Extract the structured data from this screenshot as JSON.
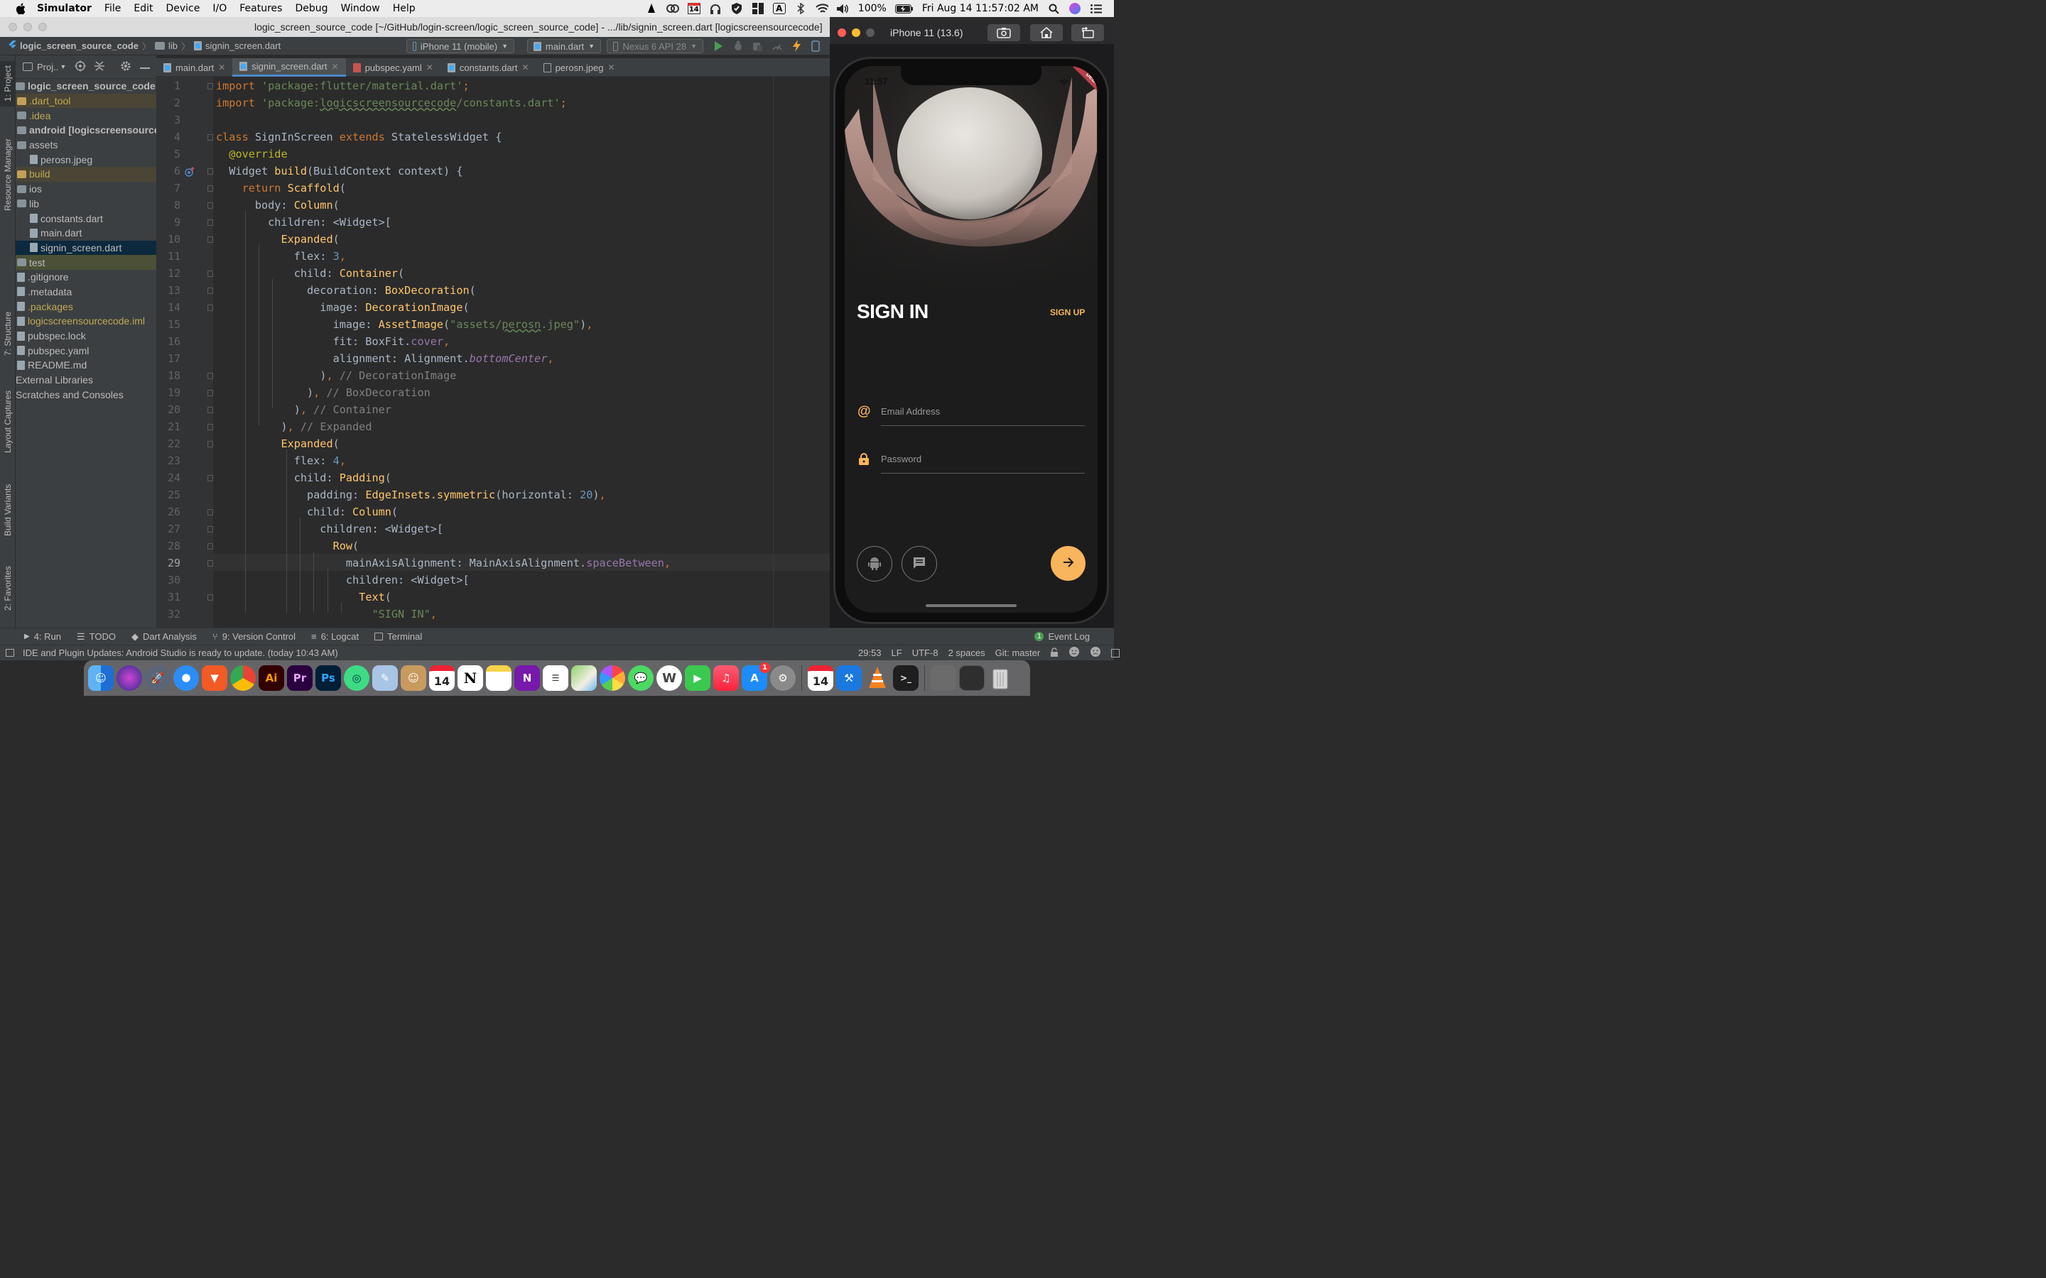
{
  "menubar": {
    "app": "Simulator",
    "items": [
      "File",
      "Edit",
      "Device",
      "I/O",
      "Features",
      "Debug",
      "Window",
      "Help"
    ],
    "calendar_day": "14",
    "battery": "100%",
    "datetime": "Fri Aug 14  11:57:02 AM"
  },
  "window": {
    "title": "logic_screen_source_code [~/GitHub/login-screen/logic_screen_source_code] - .../lib/signin_screen.dart [logicscreensourcecode]"
  },
  "navbar": {
    "crumbs": [
      "logic_screen_source_code",
      "lib",
      "signin_screen.dart"
    ],
    "device": "iPhone 11 (mobile)",
    "run_config": "main.dart",
    "avd": "Nexus 6 API 28"
  },
  "sidebar_tabs": [
    "1: Project",
    "Resource Manager",
    "7: Structure",
    "Layout Captures",
    "Build Variants",
    "2: Favorites"
  ],
  "project": {
    "header": "Proj..",
    "tree": [
      {
        "label": "logic_screen_source_code [logi",
        "indent": 0,
        "kind": "folder",
        "style": "bold"
      },
      {
        "label": ".dart_tool",
        "indent": 1,
        "kind": "folder-y",
        "style": "yellow",
        "hl": "y"
      },
      {
        "label": ".idea",
        "indent": 1,
        "kind": "folder",
        "style": "yellow"
      },
      {
        "label": "android [logicscreensourcec",
        "indent": 1,
        "kind": "folder",
        "style": "bold"
      },
      {
        "label": "assets",
        "indent": 1,
        "kind": "folder",
        "style": ""
      },
      {
        "label": "perosn.jpeg",
        "indent": 2,
        "kind": "file",
        "style": ""
      },
      {
        "label": "build",
        "indent": 1,
        "kind": "folder-y",
        "style": "yellow",
        "hl": "y"
      },
      {
        "label": "ios",
        "indent": 1,
        "kind": "folder",
        "style": ""
      },
      {
        "label": "lib",
        "indent": 1,
        "kind": "folder",
        "style": ""
      },
      {
        "label": "constants.dart",
        "indent": 2,
        "kind": "dart",
        "style": ""
      },
      {
        "label": "main.dart",
        "indent": 2,
        "kind": "dart",
        "style": ""
      },
      {
        "label": "signin_screen.dart",
        "indent": 2,
        "kind": "dart",
        "style": "",
        "hl": "sel"
      },
      {
        "label": "test",
        "indent": 1,
        "kind": "folder",
        "style": "",
        "hl": "g"
      },
      {
        "label": ".gitignore",
        "indent": 1,
        "kind": "file",
        "style": ""
      },
      {
        "label": ".metadata",
        "indent": 1,
        "kind": "file",
        "style": ""
      },
      {
        "label": ".packages",
        "indent": 1,
        "kind": "file",
        "style": "yellow"
      },
      {
        "label": "logicscreensourcecode.iml",
        "indent": 1,
        "kind": "file",
        "style": "yellow"
      },
      {
        "label": "pubspec.lock",
        "indent": 1,
        "kind": "file",
        "style": ""
      },
      {
        "label": "pubspec.yaml",
        "indent": 1,
        "kind": "file",
        "style": ""
      },
      {
        "label": "README.md",
        "indent": 1,
        "kind": "file",
        "style": ""
      },
      {
        "label": "External Libraries",
        "indent": 0,
        "kind": "none",
        "style": ""
      },
      {
        "label": "Scratches and Consoles",
        "indent": 0,
        "kind": "none",
        "style": ""
      }
    ]
  },
  "tabs": [
    "main.dart",
    "signin_screen.dart",
    "pubspec.yaml",
    "constants.dart",
    "perosn.jpeg"
  ],
  "active_tab": 1,
  "editor": {
    "current_line": 29,
    "lines": [
      "<span class=\"kw\">import </span><span class=\"str\">'package:flutter/material.dart'</span><span class=\"kw\">;</span>",
      "<span class=\"kw\">import </span><span class=\"str\">'package:<span class=\"ul\">logicscreensourcecode</span>/constants.dart'</span><span class=\"kw\">;</span>",
      "",
      "<span class=\"kw\">class </span>SignInScreen <span class=\"kw\">extends </span>StatelessWidget {",
      "  <span class=\"ann\">@override</span>",
      "  Widget <span class=\"cls\">build</span>(BuildContext context) {",
      "    <span class=\"kw\">return </span><span class=\"cls\">Scaffold</span>(",
      "      body: <span class=\"cls\">Column</span>(",
      "        children: &lt;Widget&gt;[",
      "          <span class=\"cls\">Expanded</span>(",
      "            flex: <span class=\"num\">3</span><span class=\"kw\">,</span>",
      "            child: <span class=\"cls\">Container</span>(",
      "              decoration: <span class=\"cls\">BoxDecoration</span>(",
      "                image: <span class=\"cls\">DecorationImage</span>(",
      "                  image: <span class=\"cls\">AssetImage</span>(<span class=\"str\">\"assets/<span class=\"ul\">perosn</span>.jpeg\"</span>)<span class=\"kw\">,</span>",
      "                  fit: BoxFit.<span class=\"fld\">cover</span><span class=\"kw\">,</span>",
      "                  alignment: Alignment.<span class=\"fld it\">bottomCenter</span><span class=\"kw\">,</span>",
      "                )<span class=\"kw\">, </span><span class=\"cm\">// DecorationImage</span>",
      "              )<span class=\"kw\">, </span><span class=\"cm\">// BoxDecoration</span>",
      "            )<span class=\"kw\">, </span><span class=\"cm\">// Container</span>",
      "          )<span class=\"kw\">, </span><span class=\"cm\">// Expanded</span>",
      "          <span class=\"cls\">Expanded</span>(",
      "            flex: <span class=\"num\">4</span><span class=\"kw\">,</span>",
      "            child: <span class=\"cls\">Padding</span>(",
      "              padding: <span class=\"cls\">EdgeInsets.symmetric</span>(horizontal: <span class=\"num\">20</span>)<span class=\"kw\">,</span>",
      "              child: <span class=\"cls\">Column</span>(",
      "                children: &lt;Widget&gt;[",
      "                  <span class=\"cls\">Row</span>(",
      "                    mainAxisAlignment: MainAxisAlignment.<span class=\"fld\">spaceBetween</span><span class=\"kw\">,</span>",
      "                    children: &lt;Widget&gt;[",
      "                      <span class=\"cls\">Text</span>(",
      "                        <span class=\"str\">\"SIGN IN\"</span><span class=\"kw\">,</span>"
    ]
  },
  "toolwindows": [
    "4: Run",
    "TODO",
    "Dart Analysis",
    "9: Version Control",
    "6: Logcat",
    "Terminal"
  ],
  "event_log": {
    "count": "1",
    "label": "Event Log"
  },
  "status": {
    "message": "IDE and Plugin Updates: Android Studio is ready to update. (today 10:43 AM)",
    "position": "29:53",
    "line_sep": "LF",
    "encoding": "UTF-8",
    "indent": "2 spaces",
    "vcs": "Git: master"
  },
  "simulator": {
    "title": "iPhone 11 (13.6)",
    "time": "11:57",
    "debug_banner": "DEBUG",
    "heading": "SIGN IN",
    "signup": "SIGN UP",
    "email_placeholder": "Email Address",
    "password_placeholder": "Password",
    "accent": "#f8b55b"
  },
  "dock": {
    "calendar_day": "14",
    "appstore_badge": "1",
    "apps": [
      "Finder",
      "Siri",
      "Launchpad",
      "Safari",
      "Brave",
      "Chrome",
      "Illustrator",
      "Premiere Pro",
      "Photoshop",
      "Android Studio",
      "Preview",
      "Contacts",
      "Calendar",
      "Notion",
      "Notes",
      "OneNote",
      "Reminders",
      "Maps",
      "Photos",
      "Messages",
      "WordPress",
      "FaceTime",
      "Music",
      "App Store",
      "System Preferences",
      "Calendar",
      "Xcode",
      "VLC",
      "Terminal",
      "Downloads",
      "Recent",
      "Trash"
    ]
  }
}
